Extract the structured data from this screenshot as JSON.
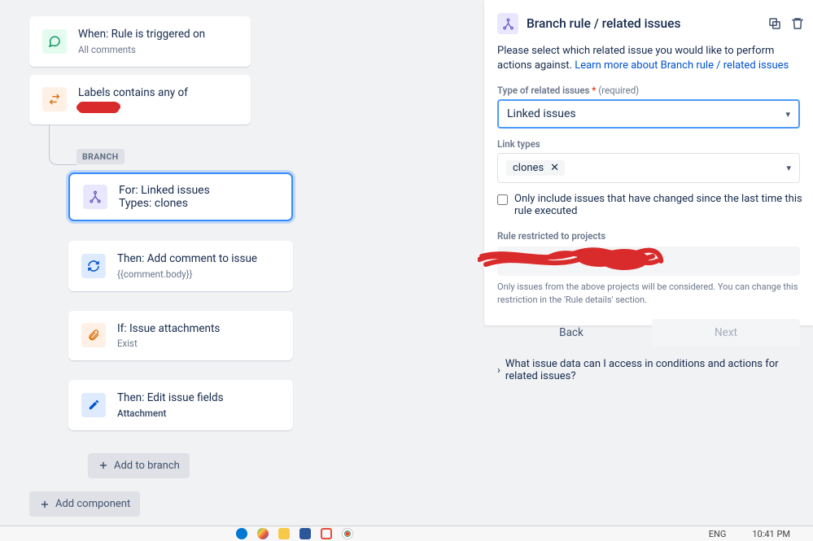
{
  "flow": {
    "trigger": {
      "title": "When: Rule is triggered on",
      "sub": "All comments"
    },
    "condition": {
      "title": "Labels contains any of"
    },
    "branch_label": "BRANCH",
    "branch_card": {
      "title": "For: Linked issues",
      "sub": "Types: clones"
    },
    "steps": [
      {
        "title": "Then: Add comment to issue",
        "sub": "{{comment.body}}",
        "kind": "action"
      },
      {
        "title": "If: Issue attachments",
        "sub": "Exist",
        "kind": "cond"
      },
      {
        "title": "Then: Edit issue fields",
        "sub": "Attachment",
        "kind": "action2"
      }
    ],
    "add_to_branch": "Add to branch",
    "add_component": "Add component"
  },
  "panel": {
    "title": "Branch rule / related issues",
    "desc_a": "Please select which related issue you would like to perform actions against. ",
    "desc_link": "Learn more about Branch rule / related issues",
    "type_label": "Type of related issues",
    "required": "(required)",
    "type_value": "Linked issues",
    "link_types_label": "Link types",
    "link_types_chip": "clones",
    "only_changed": "Only include issues that have changed since the last time this rule executed",
    "restricted_label": "Rule restricted to projects",
    "helper": "Only issues from the above projects will be considered. You can change this restriction in the 'Rule details' section.",
    "back": "Back",
    "next": "Next",
    "expand": "What issue data can I access in conditions and actions for related issues?"
  },
  "taskbar": {
    "lang": "ENG",
    "time": "10:41 PM"
  }
}
